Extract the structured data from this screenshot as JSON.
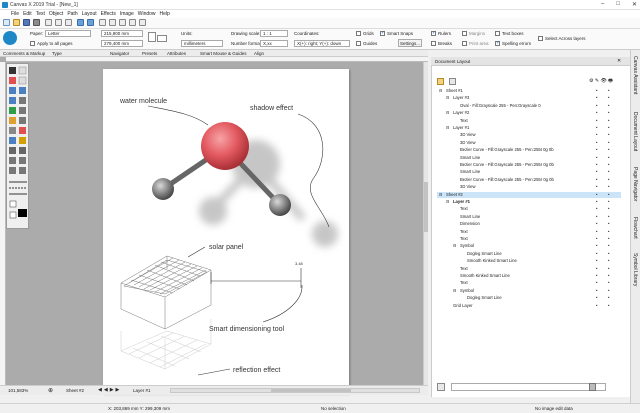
{
  "window": {
    "title": "Canvas X 2019 Trial - [New_1]",
    "controls": [
      "–",
      "□",
      "✕"
    ]
  },
  "menu": [
    "File",
    "Edit",
    "Text",
    "Object",
    "Path",
    "Layout",
    "Effects",
    "Image",
    "Window",
    "Help"
  ],
  "props": {
    "paper_label": "Paper:",
    "paper_value": "Letter",
    "apply_all_label": "Apply to all pages",
    "width_value": "215,900 mm",
    "height_value": "279,400 mm",
    "units_label": "Units:",
    "units_value": "millimeters",
    "drawing_scale_label": "Drawing scale:",
    "drawing_scale_value": "1 : 1",
    "number_format_label": "Number format:",
    "number_format_value": "X,xx",
    "coordinates_label": "Coordinates:",
    "coordinates_value": "X(+): right; Y(+): down",
    "grids_label": "Grids",
    "guides_label": "Guides",
    "smart_snaps_label": "Smart Snaps",
    "settings_label": "Settings...",
    "rulers_label": "Rulers",
    "breaks_label": "Breaks",
    "margins_label": "Margins",
    "print_area_label": "Print area",
    "text_boxes_label": "Text boxes",
    "spelling_label": "Spelling errors",
    "select_across_label": "Select Across layers"
  },
  "tabs": [
    "Comments & Markup",
    "Type",
    "Navigator",
    "Presets",
    "Attributes",
    "Smart Mouse & Guides",
    "Align"
  ],
  "canvas": {
    "annotations": {
      "water_molecule": "water molecule",
      "shadow_effect": "shadow effect",
      "solar_panel": "solar panel",
      "smart_dim": "Smart dimensioning tool",
      "reflection": "reflection effect",
      "dim_value": "3,48"
    }
  },
  "bottom": {
    "zoom": "101,583%",
    "sheet": "Sheet #2",
    "layer": "Layer #1",
    "coords": "X: 203,869 mm Y: 299,309 mm",
    "no_selection": "No selection",
    "no_image": "No image edit data"
  },
  "panel": {
    "title": "Document Layout",
    "tree": [
      {
        "label": "Sheet #1",
        "indent": 0,
        "sign": "−"
      },
      {
        "label": "Layer #3",
        "indent": 1,
        "sign": "−"
      },
      {
        "label": "Oval - Fill:Grayscale 255 - Pen:Grayscale 0",
        "indent": 2,
        "sign": ""
      },
      {
        "label": "Layer #2",
        "indent": 1,
        "sign": "−"
      },
      {
        "label": "Text",
        "indent": 2,
        "sign": ""
      },
      {
        "label": "Layer #1",
        "indent": 1,
        "sign": "−"
      },
      {
        "label": "3D View",
        "indent": 2,
        "sign": ""
      },
      {
        "label": "3D View",
        "indent": 2,
        "sign": ""
      },
      {
        "label": "Bezier Curve - Fill:Grayscale 255 - Pen:255t 0g 0b",
        "indent": 2,
        "sign": ""
      },
      {
        "label": "Smart Line",
        "indent": 2,
        "sign": ""
      },
      {
        "label": "Bezier Curve - Fill:Grayscale 255 - Pen:255r 0g 0b",
        "indent": 2,
        "sign": ""
      },
      {
        "label": "Smart Line",
        "indent": 2,
        "sign": ""
      },
      {
        "label": "Bezier Curve - Fill:Grayscale 255 - Pen:255r 0g 0b",
        "indent": 2,
        "sign": ""
      },
      {
        "label": "3D View",
        "indent": 2,
        "sign": ""
      },
      {
        "label": "Sheet #2",
        "indent": 0,
        "sign": "−",
        "selected": true
      },
      {
        "label": "Layer #1",
        "indent": 1,
        "sign": "−",
        "bold": true
      },
      {
        "label": "Text",
        "indent": 2,
        "sign": ""
      },
      {
        "label": "Smart Line",
        "indent": 2,
        "sign": ""
      },
      {
        "label": "Dimension",
        "indent": 2,
        "sign": ""
      },
      {
        "label": "Text",
        "indent": 2,
        "sign": ""
      },
      {
        "label": "Text",
        "indent": 2,
        "sign": ""
      },
      {
        "label": "Symbol",
        "indent": 2,
        "sign": "−"
      },
      {
        "label": "Dogleg Smart Line",
        "indent": 3,
        "sign": ""
      },
      {
        "label": "Smooth Kinked Smart Line",
        "indent": 3,
        "sign": ""
      },
      {
        "label": "Text",
        "indent": 2,
        "sign": ""
      },
      {
        "label": "Smooth Kinked Smart Line",
        "indent": 2,
        "sign": ""
      },
      {
        "label": "Text",
        "indent": 2,
        "sign": ""
      },
      {
        "label": "Symbol",
        "indent": 2,
        "sign": "−"
      },
      {
        "label": "Dogleg Smart Line",
        "indent": 3,
        "sign": ""
      },
      {
        "label": "Grid Layer",
        "indent": 1,
        "sign": ""
      }
    ],
    "dot": "•"
  },
  "side_tabs": [
    "Canvas Assistant",
    "Document Layout",
    "Page Navigator",
    "Flowchart",
    "Symbol Library"
  ],
  "colors": {
    "accent": "#1e88c7",
    "sphere_red": "#e2585f",
    "selection": "#cce4f7"
  }
}
